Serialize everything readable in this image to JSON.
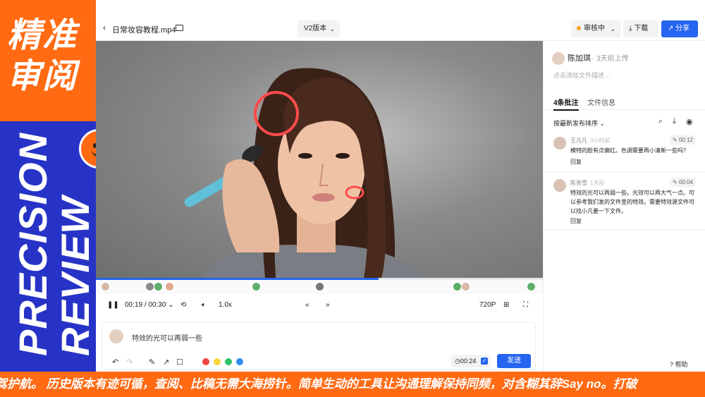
{
  "promo": {
    "cn_title_line1": "精准",
    "cn_title_line2": "审阅",
    "en_line1": "PRECISION",
    "en_line2": "REVIEW"
  },
  "ticker": {
    "text": "保驾护航。 历史版本有迹可循，查阅、比稿无需大海捞针。简单生动的工具让沟通理解保持同频，对含糊其辞Say no。打破"
  },
  "topbar": {
    "back_icon": "chevron-left-icon",
    "filename": "日常妆容教程.mp4",
    "folder_icon": "folder-icon",
    "version_label": "V2版本",
    "status_label": "审核中",
    "download_label": "下载",
    "share_label": "分享"
  },
  "player": {
    "progress": 0.633,
    "current_time": "00:19",
    "separator": "/",
    "total_time": "00:30",
    "speed": "1.0x",
    "prev_label": "«",
    "next_label": "»",
    "quality": "720P"
  },
  "composer": {
    "text": "特效的光可以再弱一些",
    "timecode": "00:24",
    "send_label": "发送",
    "colors": [
      "#ee4545",
      "#f8d43a",
      "#2ec26a",
      "#2f8cf0"
    ]
  },
  "panel": {
    "uploader_name": "陈加琪",
    "uploader_meta": "· 3天前上传",
    "description_placeholder": "点击添加文件描述...",
    "tab_comments": "4条批注",
    "tab_info": "文件信息",
    "sort_label": "按最新发布排序",
    "comments": [
      {
        "name": "王凡凡",
        "when": "3小时前",
        "timecode": "00:12",
        "body": "模特的脸有点偏红。色调需要再小清新一些吗？",
        "reply": "回复"
      },
      {
        "name": "陈贵雪",
        "when": "1天前",
        "timecode": "00:04",
        "body": "特效的光可以再弱一些。光效可以再大气一点。可以参考我们发的文件里的特效。需要特效源文件可以找小凡要一下文件。",
        "reply": "回复"
      }
    ]
  },
  "help_label": "帮助"
}
